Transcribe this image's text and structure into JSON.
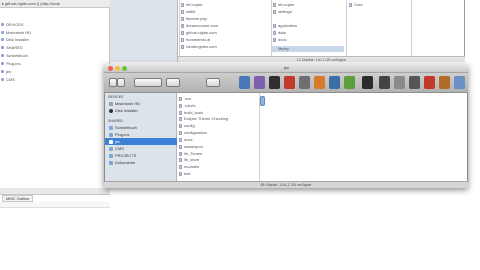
{
  "eclipse": {
    "breadcrumb": "▸ github-rights.com § (http://svnk",
    "tree": [
      {
        "label": "DEVICES",
        "sel": false
      },
      {
        "label": "Macintosh HD",
        "sel": false
      },
      {
        "label": "Disk Installer",
        "sel": false
      },
      {
        "label": "SHARED",
        "sel": false
      },
      {
        "label": "Schnellbuch",
        "sel": false
      },
      {
        "label": "Plug-ins",
        "sel": false
      },
      {
        "label": "jen",
        "sel": false
      },
      {
        "label": "CMS",
        "sel": false
      }
    ],
    "panel_tab": "MMC Outline"
  },
  "finder_back": {
    "col1": [
      "htf.copter",
      "stdlib",
      "flumme.php",
      "dreamcourse.com",
      "github-rights.com",
      "hummersto.ai",
      "randengines.com"
    ],
    "col2": [
      "htf.copter",
      "settings",
      "application",
      "data",
      "docs",
      "library"
    ],
    "col3": [
      "Core"
    ],
    "status": "13 Objekte, 140,1 GB verfügbar"
  },
  "finder_front": {
    "title": "jen",
    "sidebar": {
      "devices_header": "DEVICES",
      "devices": [
        "Macintosh HD",
        "Disk Installer"
      ],
      "shared_header": "SHARED",
      "shared": [
        "Schnellbuch",
        "Plug-ins",
        "jen",
        "CMS",
        "PROJECTS",
        "Dokumente"
      ]
    },
    "files": [
      ".svn",
      ".cdn/in",
      "build_tools",
      "Eclipse Theme Checking",
      "config",
      "configuration",
      "docs",
      "dataexport",
      "lib_Tomes",
      "lib_store",
      "modules",
      "test"
    ],
    "status": "58 Objekte, 1101,1 GB verfügbar"
  }
}
